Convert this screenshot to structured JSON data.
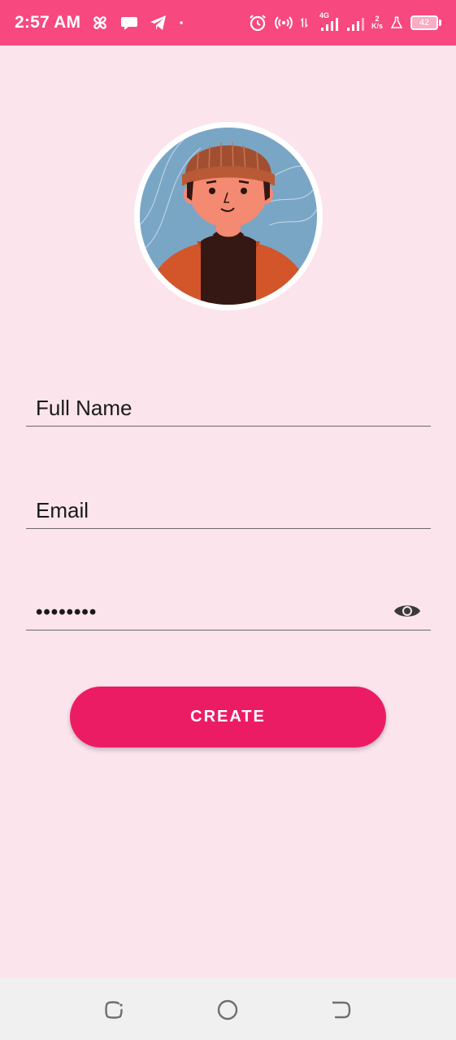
{
  "status_bar": {
    "time": "2:57 AM",
    "network_type": "4G",
    "net_speed_value": "2",
    "net_speed_unit": "K/s",
    "battery": "42",
    "icons": [
      "pinwheel-icon",
      "chat-bubble-icon",
      "telegram-icon",
      "dot-icon",
      "alarm-icon",
      "hotspot-icon",
      "data-transfer-icon",
      "signal-icon",
      "signal-icon",
      "lab-flask-icon",
      "battery-icon"
    ]
  },
  "form": {
    "full_name_placeholder": "Full Name",
    "email_placeholder": "Email",
    "password_masked": "••••••••",
    "create_label": "CREATE"
  },
  "colors": {
    "status_bar": "#f7487f",
    "background": "#fbe4ec",
    "button": "#ec1c64",
    "nav_bar": "#f1f0f0"
  }
}
